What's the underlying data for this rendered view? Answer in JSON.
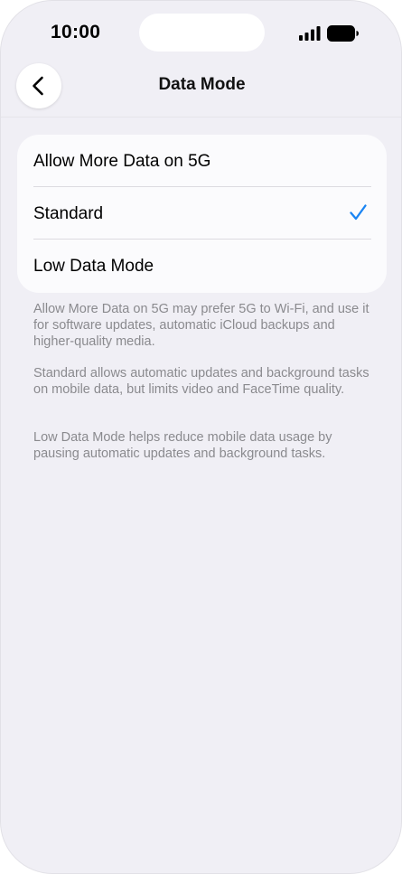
{
  "status_bar": {
    "time": "10:00",
    "signal_icon": "cellular-signal-icon",
    "battery_icon": "battery-icon"
  },
  "nav": {
    "back_icon": "chevron-left-icon",
    "title": "Data Mode"
  },
  "options": [
    {
      "label": "Allow More Data on 5G",
      "selected": false
    },
    {
      "label": "Standard",
      "selected": true
    },
    {
      "label": "Low Data Mode",
      "selected": false
    }
  ],
  "descriptions": [
    "Allow More Data on 5G may prefer 5G to Wi-Fi, and use it for software updates, automatic iCloud backups and higher-quality media.",
    "Standard allows automatic updates and background tasks on mobile data, but limits video and FaceTime quality.",
    "Low Data Mode helps reduce mobile data usage by pausing automatic updates and background tasks."
  ],
  "colors": {
    "background": "#f0eff5",
    "card": "#fbfbfd",
    "accent": "#1a84f3",
    "secondary_text": "#8a8a8e"
  }
}
